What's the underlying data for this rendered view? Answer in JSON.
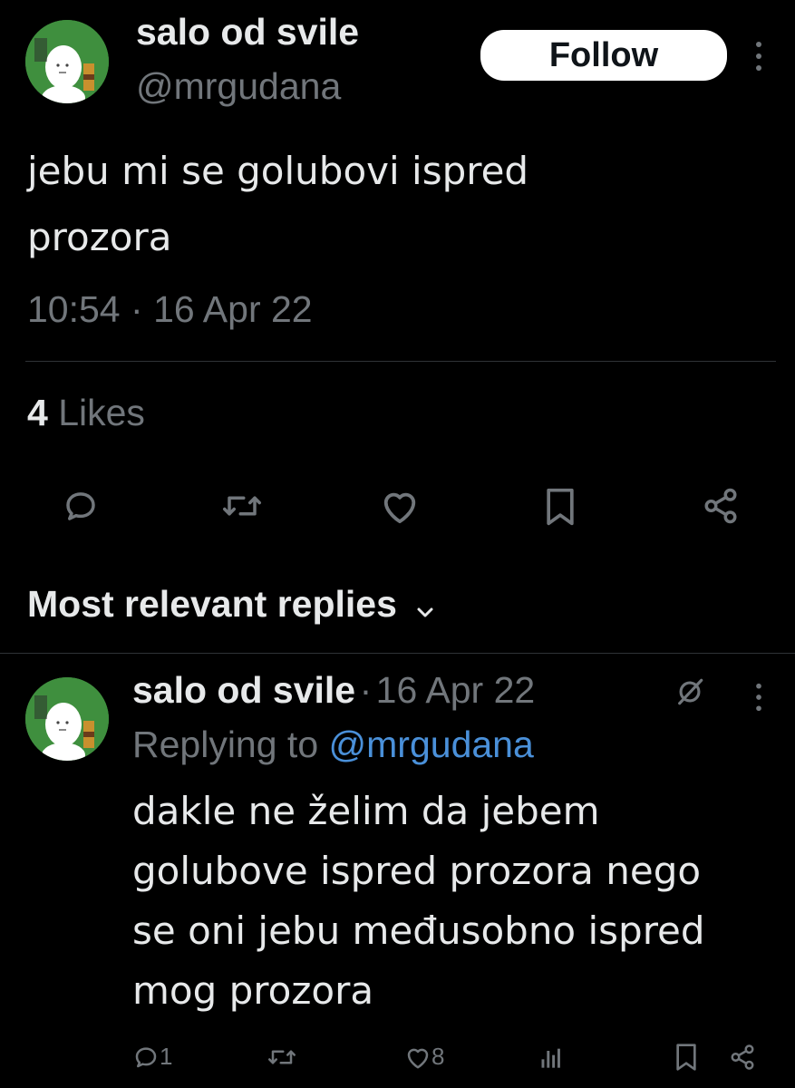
{
  "tweet": {
    "author_name": "salo od svile",
    "author_handle": "@mrgudana",
    "follow_label": "Follow",
    "text": "jebu mi se golubovi ispred\nprozora",
    "time": "10:54",
    "separator": "·",
    "date": "16 Apr 22",
    "likes_count": "4",
    "likes_label": "Likes",
    "actions": [
      "reply-icon",
      "retweet-icon",
      "like-icon",
      "bookmark-icon",
      "share-icon"
    ]
  },
  "replies_section": {
    "title": "Most relevant replies"
  },
  "reply": {
    "author_name": "salo od svile",
    "separator": "·",
    "date": "16 Apr 22",
    "replying_prefix": "Replying to",
    "replying_handle": "@mrgudana",
    "text": "dakle ne želim da jebem\ngolubove ispred prozora nego\nse oni jebu međusobno ispred\nmog prozora",
    "reply_count": "1",
    "like_count": "8"
  },
  "colors": {
    "background": "#000000",
    "text": "#e7e9ea",
    "muted": "#71767b",
    "link": "#4a90d9",
    "avatar_bg": "#3f8f3e"
  }
}
